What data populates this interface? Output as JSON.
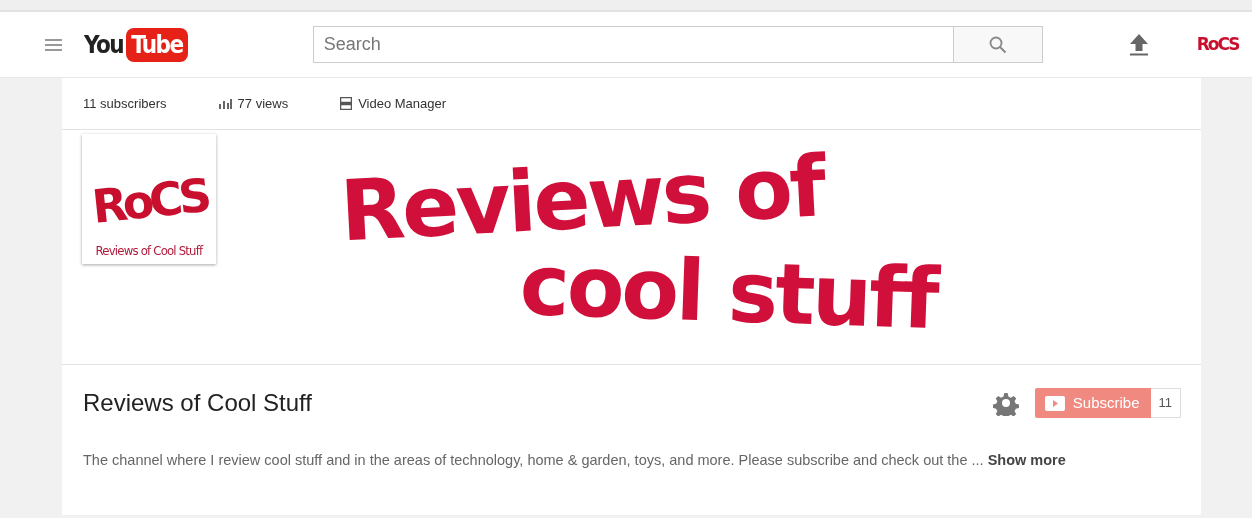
{
  "masthead": {
    "logo_left": "You",
    "logo_right": "Tube",
    "search": {
      "placeholder": "Search"
    },
    "account_avatar": "RoCS"
  },
  "stats": [
    {
      "kind": "plain",
      "label": "11 subscribers"
    },
    {
      "kind": "views",
      "label": "77 views"
    },
    {
      "kind": "manager",
      "label": "Video Manager"
    }
  ],
  "banner": {
    "lines": [
      "Reviews of",
      "cool stuff"
    ]
  },
  "channel_avatar": {
    "initials": "RoCS",
    "caption": "Reviews of Cool Stuff"
  },
  "channel": {
    "title": "Reviews of Cool Stuff",
    "subscribe_label": "Subscribe",
    "subscriber_count": "11"
  },
  "description": {
    "text": "The channel where I review cool stuff and in the areas of technology, home & garden, toys, and more. Please subscribe and check out the ...",
    "link": "Show more"
  }
}
